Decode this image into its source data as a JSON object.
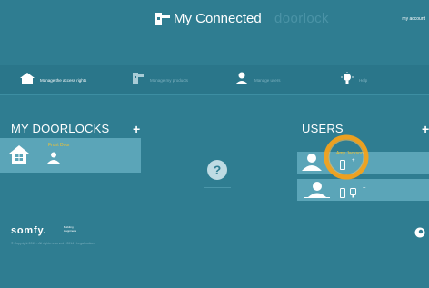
{
  "header": {
    "title": "My Connected",
    "brand": "doorlock",
    "account": "my account"
  },
  "nav": {
    "items": [
      {
        "label": "Manage the access rights",
        "icon": "house-icon",
        "active": true
      },
      {
        "label": "Manage my products",
        "icon": "doorlock-icon",
        "active": false
      },
      {
        "label": "Manage users",
        "icon": "user-icon",
        "active": false
      },
      {
        "label": "Help",
        "icon": "lightbulb-icon",
        "active": false
      }
    ]
  },
  "doorlocks": {
    "title": "MY DOORLOCKS",
    "add": "+",
    "items": [
      {
        "name": "Front Door",
        "icon": "house-icon"
      }
    ]
  },
  "help": {
    "symbol": "?"
  },
  "users": {
    "title": "USERS",
    "add": "+",
    "items": [
      {
        "name": "Amy Jackson",
        "icons": [
          "phone-icon"
        ],
        "add": "+"
      },
      {
        "name": "",
        "icons": [
          "phone-icon",
          "keyfob-icon"
        ],
        "add": "+"
      }
    ]
  },
  "footer": {
    "logo": "somfy.",
    "tagline_1": "Building",
    "tagline_2": "Happiness",
    "copyright": "© Copyright 2015 - All rights reserved - 2014 - Legal notices"
  },
  "colors": {
    "background": "#2f7d91",
    "card": "#5ba5b8",
    "accent": "#f4c22e",
    "highlight": "#f6a21b"
  }
}
